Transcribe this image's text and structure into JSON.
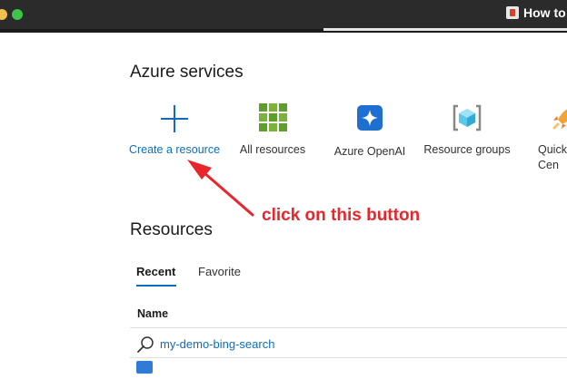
{
  "browser": {
    "tab_title": "How to"
  },
  "azure_services": {
    "title": "Azure services",
    "items": [
      {
        "label": "Create a resource",
        "icon": "plus-icon"
      },
      {
        "label": "All resources",
        "icon": "grid-icon"
      },
      {
        "label": "Azure OpenAI",
        "icon": "openai-icon"
      },
      {
        "label": "Resource groups",
        "icon": "resource-groups-icon"
      },
      {
        "label": "Quick Cen",
        "icon": "rocket-icon"
      }
    ]
  },
  "resources": {
    "title": "Resources",
    "tabs": [
      {
        "label": "Recent",
        "active": true
      },
      {
        "label": "Favorite",
        "active": false
      }
    ],
    "column_name": "Name",
    "rows": [
      {
        "name": "my-demo-bing-search",
        "icon": "search-icon"
      },
      {
        "name": "",
        "icon": "translator-icon"
      }
    ]
  },
  "annotation": {
    "text": "click on this button",
    "color": "#e8262b"
  },
  "colors": {
    "accent": "#0f6cbd",
    "titlebar": "#2b2b2b"
  }
}
